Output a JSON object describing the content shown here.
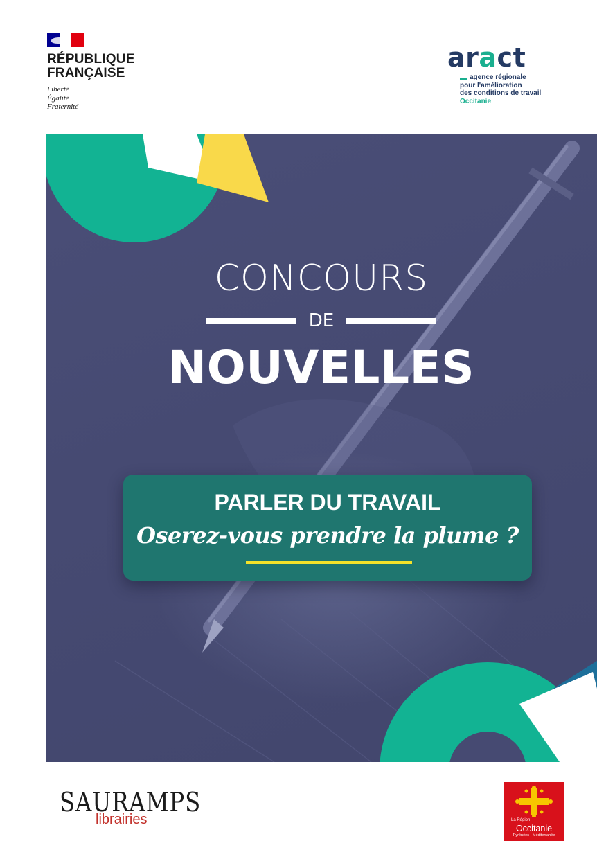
{
  "header": {
    "republique_logo": {
      "name_line1": "RÉPUBLIQUE",
      "name_line2": "FRANÇAISE",
      "motto_line1": "Liberté",
      "motto_line2": "Égalité",
      "motto_line3": "Fraternité"
    },
    "aract_logo": {
      "wordmark_a": "ar",
      "wordmark_b": "a",
      "wordmark_c": "ct",
      "line1": "agence régionale",
      "line2": "pour l'amélioration",
      "line3": "des conditions de travail",
      "region": "Occitanie"
    }
  },
  "hero": {
    "title_top": "CONCOURS",
    "title_connector": "DE",
    "title_main": "NOUVELLES",
    "banner": {
      "title": "PARLER DU TRAVAIL",
      "tagline": "Oserez-vous prendre la plume ?"
    },
    "colors": {
      "background": "#464a72",
      "teal": "#12b393",
      "yellow": "#f9d94a",
      "blue": "#1d6f9a",
      "banner": "#1f766f",
      "underline": "#f4e12a"
    }
  },
  "footer": {
    "sauramps_logo": {
      "wordmark": "SAURAMPS",
      "sub": "librairies"
    },
    "occitanie_logo": {
      "small": "La Région",
      "name": "Occitanie",
      "sub": "Pyrénées · Méditerranée"
    }
  }
}
